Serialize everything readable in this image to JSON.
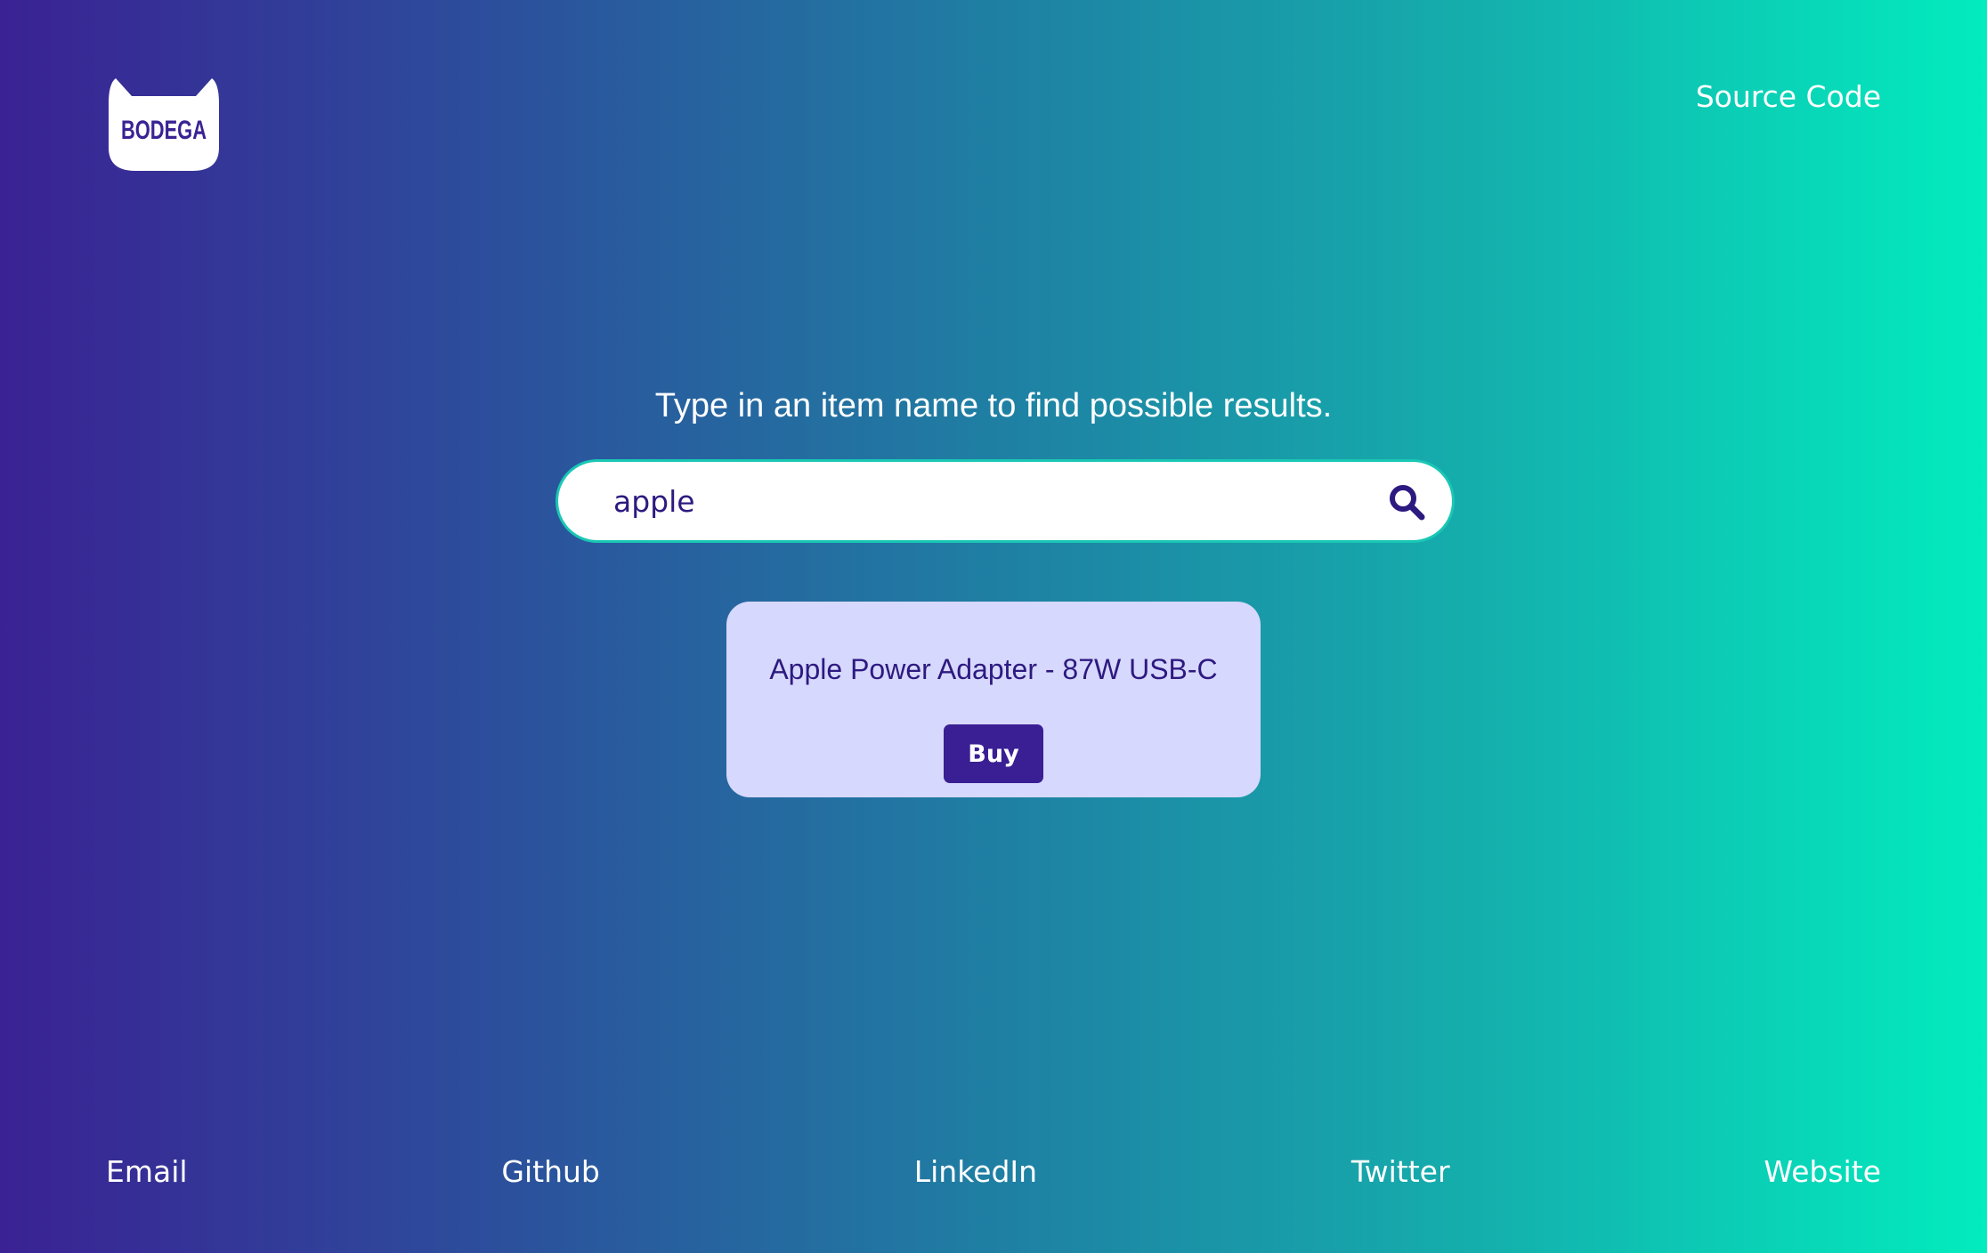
{
  "header": {
    "logo_text": "BODEGA",
    "source_code_label": "Source Code"
  },
  "main": {
    "prompt": "Type in an item name to find possible results.",
    "search": {
      "value": "apple",
      "icon": "search-icon"
    },
    "results": [
      {
        "title": "Apple Power Adapter - 87W USB-C",
        "buy_label": "Buy"
      }
    ]
  },
  "footer": {
    "links": [
      "Email",
      "Github",
      "LinkedIn",
      "Twitter",
      "Website"
    ]
  },
  "colors": {
    "gradient_start": "#3a2294",
    "gradient_end": "#02ecbe",
    "accent": "#3a1f94",
    "card_background": "#d7d8fd",
    "search_border": "#19c7b4"
  }
}
